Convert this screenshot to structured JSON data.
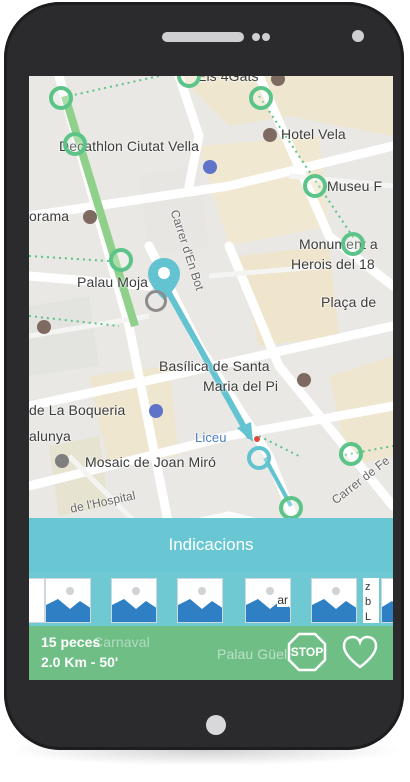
{
  "map": {
    "labels": {
      "els_4gats": "Els 4Gats",
      "hotel_vela": "Hotel Vela",
      "decathlon": "Decathlon Ciutat Vella",
      "museu": "Museu F",
      "panorama": "orama",
      "carrer_en_bot": "Carrer d'En Bot",
      "monument": "Monument a",
      "herois": "Herois del 18",
      "palau_moja": "Palau Moja",
      "placa": "Plaça de",
      "basilica_1": "Basílica de Santa",
      "basilica_2": "Maria del Pi",
      "boqueria": "de La Boqueria",
      "liceu": "Liceu",
      "catalunya": "alunya",
      "mosaic": "Mosaic de Joan Miró",
      "hospital": "de l'Hospital",
      "carrer_fe": "Carrer de Fe",
      "palau_guell": "Palau Güell",
      "carnaval": "Carnaval"
    }
  },
  "directions_button": "Indicacions",
  "thumb_strip": {
    "partial_text_1": "ar",
    "partial_text_2": "z b La"
  },
  "route_stats": {
    "pieces": "15 peces",
    "distance_time": "2.0 Km - 50'"
  },
  "stop_button": "STOP",
  "icons": [
    "pin-icon",
    "stop-icon",
    "heart-icon",
    "image-placeholder-icon"
  ],
  "colors": {
    "accent": "#69c6d3",
    "green": "#6fbe86",
    "ring_green": "#5cc489",
    "route": "#63c3d1"
  }
}
